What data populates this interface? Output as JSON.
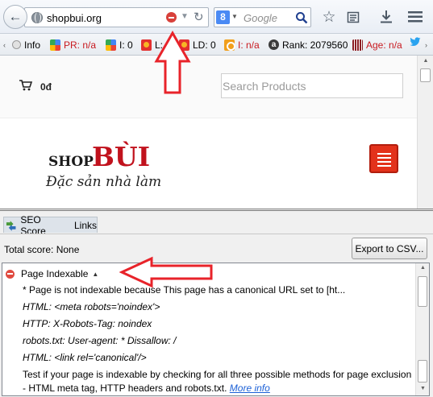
{
  "browser": {
    "url": "shopbui.org",
    "search_placeholder": "Google",
    "search_engine_letter": "8"
  },
  "seobar": {
    "info": "Info",
    "pagerank": "PR: n/a",
    "google_index": "I: 0",
    "links_domain": "L: 0",
    "links_ld": "LD: 0",
    "bing_index": "I: n/a",
    "rank": "Rank: 2079560",
    "age": "Age: n/a"
  },
  "page": {
    "cart_amount": "0đ",
    "search_placeholder": "Search Products",
    "logo_shop": "SHOP",
    "logo_bui": "BÙI",
    "logo_tagline": "Đặc sản nhà làm"
  },
  "panel": {
    "tab_score": "SEO Score",
    "tab_links": "Links",
    "total_score": "Total score: None",
    "export_label": "Export to CSV...",
    "result_title": "Page Indexable",
    "lines": [
      "* Page is not indexable because This page has a canonical URL set to [ht...",
      "HTML: <meta robots='noindex'>",
      "HTTP: X-Robots-Tag: noindex",
      "robots.txt: User-agent: * Dissallow: /",
      "HTML: <link rel='canonical'/>",
      "Test if your page is indexable by checking for all three possible methods for page exclusion",
      "- HTML meta tag, HTTP headers and robots.txt."
    ],
    "more_info": "More info"
  },
  "colors": {
    "annotation_red": "#e8232a",
    "link_blue": "#1a5fd6",
    "logo_red": "#c1121d",
    "hamburger_red": "#e3321b"
  },
  "icons": [
    "back-arrow-icon",
    "globe-icon",
    "stop-icon",
    "reload-icon",
    "google-icon",
    "magnifier-icon",
    "star-icon",
    "reading-list-icon",
    "download-icon",
    "menu-icon",
    "twitter-icon",
    "cart-icon",
    "seo-tab-icon",
    "error-icon"
  ]
}
